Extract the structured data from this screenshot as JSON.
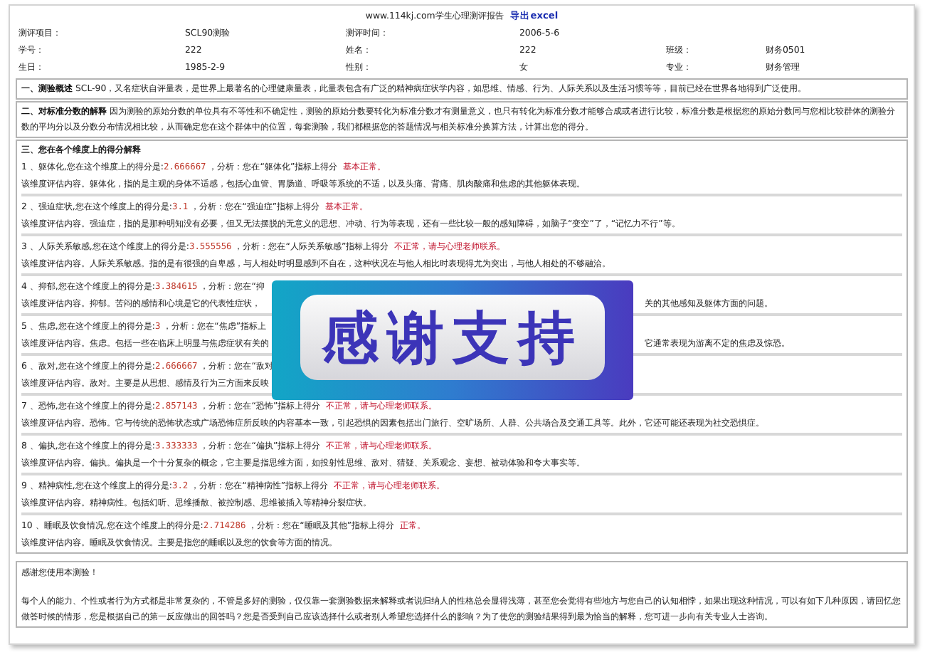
{
  "header": {
    "title": "www.114kj.com学生心理测评报告",
    "export_link": "导出excel"
  },
  "info_rows": [
    [
      {
        "label": "测评项目：",
        "value": "SCL90测验"
      },
      {
        "label": "测评时间：",
        "value": "2006-5-6"
      }
    ],
    [
      {
        "label": "学号：",
        "value": "222"
      },
      {
        "label": "姓名：",
        "value": "222"
      },
      {
        "label": "班级：",
        "value": "财务0501"
      }
    ],
    [
      {
        "label": "生日：",
        "value": "1985-2-9"
      },
      {
        "label": "性别：",
        "value": "女"
      },
      {
        "label": "专业：",
        "value": "财务管理"
      }
    ]
  ],
  "overview": {
    "title": "一、测验概述",
    "text": "SCL-90，又名症状自评量表，是世界上最著名的心理健康量表，此量表包含有广泛的精神病症状学内容，如思维、情感、行为、人际关系以及生活习惯等等，目前已经在世界各地得到广泛使用。"
  },
  "standard_score": {
    "title": "二、对标准分数的解释",
    "text": "因为测验的原始分数的单位具有不等性和不确定性，测验的原始分数要转化为标准分数才有测量意义，也只有转化为标准分数才能够合成或者进行比较，标准分数是根据您的原始分数同与您相比较群体的测验分数的平均分以及分数分布情况相比较，从而确定您在这个群体中的位置，每套测验，我们都根据您的答题情况与相关标准分换算方法，计算出您的得分。"
  },
  "dimensions": {
    "title": "三、您在各个维度上的得分解释",
    "items": [
      {
        "lead": "1 、躯体化,您在这个维度上的得分是:",
        "score": "2.666667",
        "analysis": " ，分析：您在“躯体化”指标上得分",
        "result": "基本正常。",
        "description": "该维度评估内容。躯体化，指的是主观的身体不适感，包括心血管、胃肠道、呼吸等系统的不适，以及头痛、背痛、肌肉酸痛和焦虑的其他躯体表现。"
      },
      {
        "lead": "2 、强迫症状,您在这个维度上的得分是:",
        "score": "3.1",
        "analysis": " ，分析：您在“强迫症”指标上得分",
        "result": "基本正常。",
        "description": "该维度评估内容。强迫症，指的是那种明知没有必要，但又无法摆脱的无意义的思想、冲动、行为等表现，还有一些比较一般的感知障碍，如脑子“变空”了，“记忆力不行”等。"
      },
      {
        "lead": "3 、人际关系敏感,您在这个维度上的得分是:",
        "score": "3.555556",
        "analysis": " ，分析：您在“人际关系敏感”指标上得分",
        "result": "不正常，请与心理老师联系。",
        "description": "该维度评估内容。人际关系敏感。指的是有很强的自卑感，与人相处时明显感到不自在，这种状况在与他人相比时表现得尤为突出，与他人相处的不够融洽。"
      },
      {
        "lead": "4 、抑郁,您在这个维度上的得分是:",
        "score": "3.384615",
        "analysis": " ，分析：您在“抑",
        "description": "该维度评估内容。抑郁。苦闷的感情和心境是它的代表性症状，",
        "description_right": "关的其他感知及躯体方面的问题。"
      },
      {
        "lead": "5 、焦虑,您在这个维度上的得分是:",
        "score": "3",
        "analysis": " ，分析：您在“焦虑”指标上",
        "description": "该维度评估内容。焦虑。包括一些在临床上明显与焦虑症状有关的",
        "description_right": "它通常表现为游离不定的焦虑及惊恐。"
      },
      {
        "lead": "6 、敌对,您在这个维度上的得分是:",
        "score": "2.666667",
        "analysis": " ，分析：您在“敌对",
        "description": "该维度评估内容。敌对。主要是从思想、感情及行为三方面来反映"
      },
      {
        "lead": "7 、恐怖,您在这个维度上的得分是:",
        "score": "2.857143",
        "analysis": " ，分析：您在“恐怖”指标上得分",
        "result": "不正常，请与心理老师联系。",
        "description": "该维度评估内容。恐怖。它与传统的恐怖状态或广场恐怖症所反映的内容基本一致，引起恐惧的因素包括出门旅行、空旷场所、人群、公共场合及交通工具等。此外，它还可能还表现为社交恐惧症。"
      },
      {
        "lead": "8 、偏执,您在这个维度上的得分是:",
        "score": "3.333333",
        "analysis": " ，分析：您在“偏执”指标上得分",
        "result": "不正常，请与心理老师联系。",
        "description": "该维度评估内容。偏执。偏执是一个十分复杂的概念，它主要是指思维方面，如投射性思维、敌对、猜疑、关系观念、妄想、被动体验和夸大事实等。"
      },
      {
        "lead": "9 、精神病性,您在这个维度上的得分是:",
        "score": "3.2",
        "analysis": " ，分析：您在“精神病性”指标上得分",
        "result": "不正常，请与心理老师联系。",
        "description": "该维度评估内容。精神病性。包括幻听、思维播散、被控制感、思维被插入等精神分裂症状。"
      },
      {
        "lead": "10 、睡眠及饮食情况,您在这个维度上的得分是:",
        "score": "2.714286",
        "analysis": " ，分析：您在“睡眠及其他”指标上得分",
        "result": "正常。",
        "description": "该维度评估内容。睡眠及饮食情况。主要是指您的睡眠以及您的饮食等方面的情况。"
      }
    ]
  },
  "closing": {
    "thanks": "感谢您使用本测验！",
    "text": "每个人的能力、个性或者行为方式都是非常复杂的，不管是多好的测验，仅仅靠一套测验数据来解释或者说归纳人的性格总会显得浅薄，甚至您会觉得有些地方与您自己的认知相悖，如果出现这种情况，可以有如下几种原因，请回忆您做答时候的情形，您是根据自己的第一反应做出的回答吗？您是否受到自己应该选择什么或者别人希望您选择什么的影响？为了使您的测验结果得到最为恰当的解释，您可进一步向有关专业人士咨询。"
  },
  "overlay_banner": {
    "text": "感谢支持"
  }
}
